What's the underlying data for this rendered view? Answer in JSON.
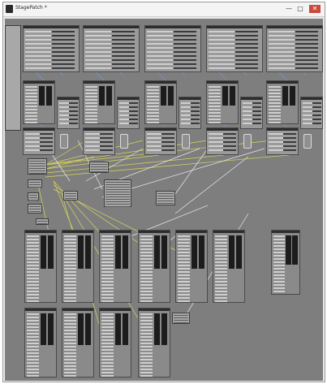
{
  "window": {
    "title": "StagePatch *",
    "controls": [
      "—",
      "□",
      "✕"
    ]
  },
  "colors": {
    "canvas": "#7e7e7e",
    "wire_yellow": "#d8d65a",
    "wire_white": "#e8e8e8",
    "wire_blue": "#6f9bd6",
    "node_header": "#2c2c2c"
  },
  "canvas": {
    "icon": "patcher-canvas"
  }
}
